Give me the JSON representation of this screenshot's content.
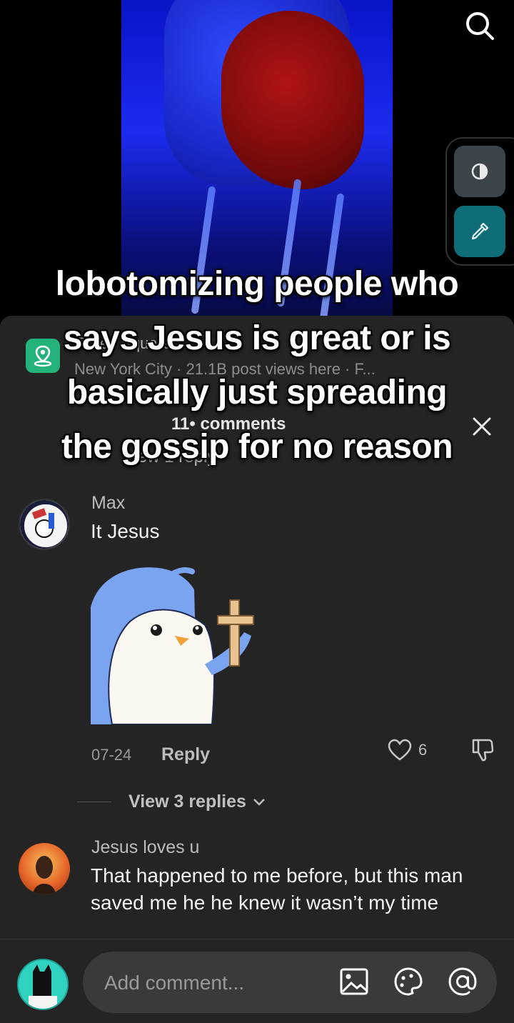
{
  "overlay": {
    "caption_lines": [
      "lobotomizing people who",
      "says Jesus is great or is",
      "basically just spreading",
      "the gossip for no reason"
    ]
  },
  "video": {
    "search_icon": "search-icon",
    "tools": [
      "contrast-icon",
      "color-picker-icon"
    ]
  },
  "location": {
    "title": "Times Square",
    "subtitle": "New York City · 21.1B post views here · F..."
  },
  "comments_sheet": {
    "header": "11• comments",
    "close_icon": "close-icon",
    "view_prev_reply": "View 1 reply"
  },
  "comments": [
    {
      "name": "Max",
      "text": "It Jesus",
      "date": "07-24",
      "reply_label": "Reply",
      "likes": "6",
      "view_replies": "View 3 replies"
    },
    {
      "name": "Jesus loves u",
      "text": "That happened to me before, but this man saved me he he knew it wasn’t my time"
    }
  ],
  "composer": {
    "placeholder": "Add comment...",
    "icons": [
      "image-icon",
      "emoji-icon",
      "mention-icon"
    ]
  },
  "colors": {
    "sheet_bg": "#242424",
    "input_bg": "#3a3a3a",
    "accent_teal": "#0f6d78",
    "location_green": "#22b27a"
  }
}
